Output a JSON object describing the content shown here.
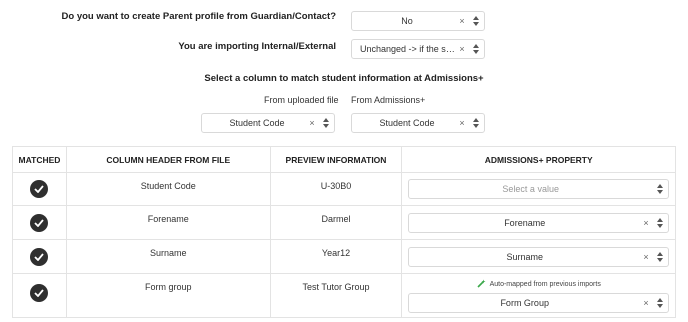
{
  "questions": [
    {
      "label": "Do you want to create Parent profile from Guardian/Contact?",
      "value": "No"
    },
    {
      "label": "You are importing Internal/External",
      "value": "Unchanged -> if the stude..."
    }
  ],
  "match_section": {
    "heading": "Select a column to match student information at Admissions+",
    "from_file_label": "From uploaded file",
    "from_admissions_label": "From Admissions+",
    "file_select_value": "Student Code",
    "admissions_select_value": "Student Code"
  },
  "table": {
    "headers": [
      "MATCHED",
      "COLUMN HEADER FROM FILE",
      "PREVIEW INFORMATION",
      "ADMISSIONS+ PROPERTY"
    ],
    "rows": [
      {
        "column": "Student Code",
        "preview": "U-30B0",
        "property": "Select a value",
        "placeholder": true,
        "note": ""
      },
      {
        "column": "Forename",
        "preview": "Darmel",
        "property": "Forename",
        "placeholder": false,
        "note": ""
      },
      {
        "column": "Surname",
        "preview": "Year12",
        "property": "Surname",
        "placeholder": false,
        "note": ""
      },
      {
        "column": "Form group",
        "preview": "Test Tutor Group",
        "property": "Form Group",
        "placeholder": false,
        "note": "Auto-mapped from previous imports"
      }
    ]
  },
  "colors": {
    "auto_icon": "#3aa84a",
    "check_bg": "#2f2f2f",
    "border": "#e3e3e3"
  },
  "icons": {
    "clear": "×",
    "check": "check-icon",
    "sort": "sort-arrows-icon",
    "auto": "magic-wand-icon"
  }
}
